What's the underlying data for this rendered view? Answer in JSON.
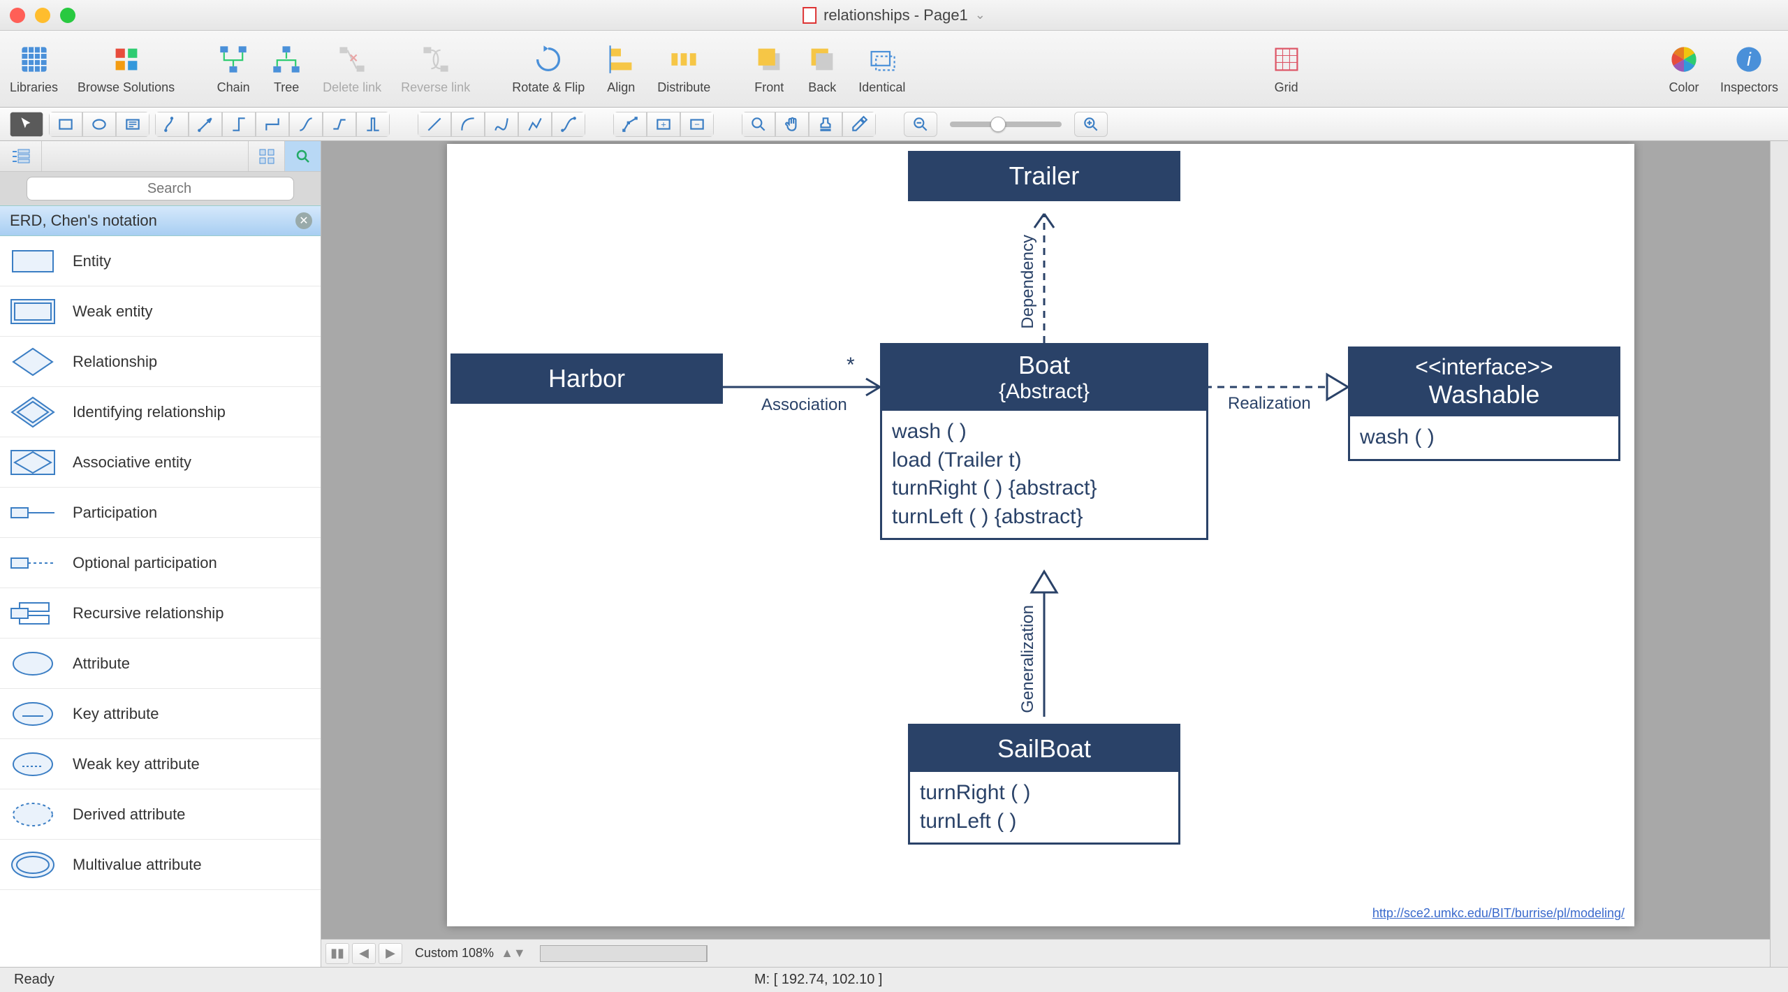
{
  "title": "relationships - Page1",
  "toolbar": {
    "libraries": "Libraries",
    "browse": "Browse Solutions",
    "chain": "Chain",
    "tree": "Tree",
    "delete_link": "Delete link",
    "reverse_link": "Reverse link",
    "rotate_flip": "Rotate & Flip",
    "align": "Align",
    "distribute": "Distribute",
    "front": "Front",
    "back": "Back",
    "identical": "Identical",
    "grid": "Grid",
    "color": "Color",
    "inspectors": "Inspectors"
  },
  "sidebar": {
    "search_placeholder": "Search",
    "section": "ERD, Chen's notation",
    "shapes": [
      "Entity",
      "Weak entity",
      "Relationship",
      "Identifying relationship",
      "Associative entity",
      "Participation",
      "Optional participation",
      "Recursive relationship",
      "Attribute",
      "Key attribute",
      "Weak key attribute",
      "Derived attribute",
      "Multivalue attribute"
    ]
  },
  "footer": {
    "zoom_text": "Custom 108%"
  },
  "status": {
    "ready": "Ready",
    "mouse": "M: [ 192.74, 102.10 ]"
  },
  "diagram": {
    "trailer": "Trailer",
    "harbor": "Harbor",
    "boat_title": "Boat",
    "boat_sub": "{Abstract}",
    "boat_m1": "wash ( )",
    "boat_m2": "load (Trailer t)",
    "boat_m3": "turnRight ( ) {abstract}",
    "boat_m4": "turnLeft ( ) {abstract}",
    "iface_stereo": "<<interface>>",
    "iface_name": "Washable",
    "iface_m1": "wash ( )",
    "sailboat": "SailBoat",
    "sailboat_m1": "turnRight ( )",
    "sailboat_m2": "turnLeft ( )",
    "assoc_mult": "*",
    "assoc_label": "Association",
    "realization": "Realization",
    "dependency": "Dependency",
    "generalization": "Generalization",
    "link": "http://sce2.umkc.edu/BIT/burrise/pl/modeling/"
  }
}
